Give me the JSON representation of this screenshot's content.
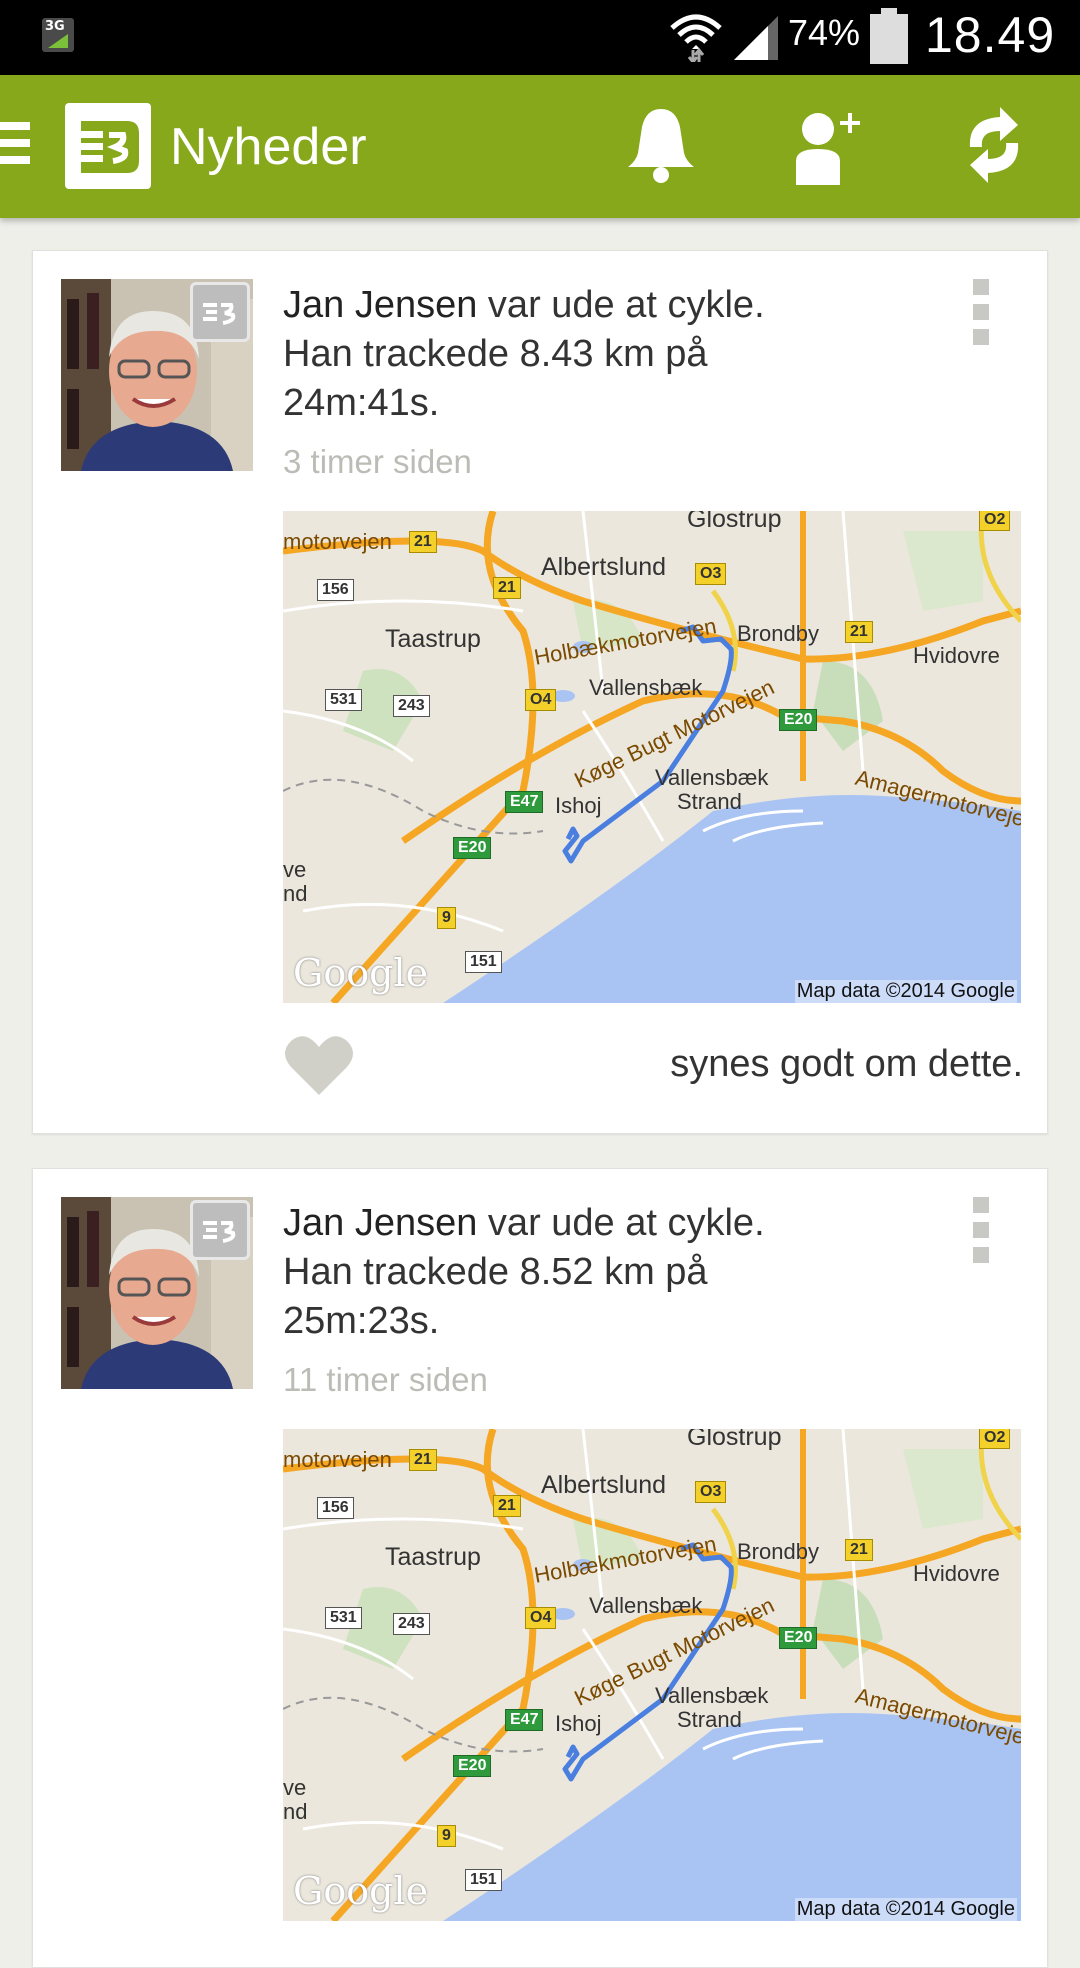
{
  "status_bar": {
    "network": "3G",
    "battery_percent": "74%",
    "time": "18.49"
  },
  "app_bar": {
    "title": "Nyheder"
  },
  "posts": [
    {
      "user": "Jan Jensen",
      "text_line1": " var ude at cykle.",
      "text_line2": "Han trackede 8.43 km på",
      "text_line3": "24m:41s.",
      "time_ago": "3 timer siden",
      "like_text": "synes godt om dette."
    },
    {
      "user": "Jan Jensen",
      "text_line1": " var ude at cykle.",
      "text_line2": "Han trackede 8.52 km på",
      "text_line3": "25m:23s.",
      "time_ago": "11 timer siden",
      "like_text": ""
    }
  ],
  "map": {
    "places": {
      "glostrup": "Glostrup",
      "albertslund": "Albertslund",
      "taastrup": "Taastrup",
      "brondby": "Brondby",
      "hvidovre": "Hvidovre",
      "vallensbaek": "Vallensbæk",
      "vallensbaek_strand_1": "Vallensbæk",
      "vallensbaek_strand_2": "Strand",
      "ishoj": "Ishoj",
      "motorvejen": "motorvejen",
      "holbaek": "Holbækmotorvejen",
      "koge": "Køge Bugt Motorvejen",
      "amager": "Amagermotorvejen",
      "ve": "ve",
      "nd": "nd"
    },
    "shields": {
      "r21a": "21",
      "r21b": "21",
      "r21c": "21",
      "o3": "O3",
      "o2": "O2",
      "o4": "O4",
      "r156": "156",
      "r531": "531",
      "r243": "243",
      "r151": "151",
      "r9": "9",
      "e20a": "E20",
      "e20b": "E20",
      "e47": "E47"
    },
    "logo": "Google",
    "copyright": "Map data ©2014 Google"
  },
  "colors": {
    "app_bar": "#86a81a",
    "route": "#4a7fe0",
    "water": "#a9c4f3"
  }
}
